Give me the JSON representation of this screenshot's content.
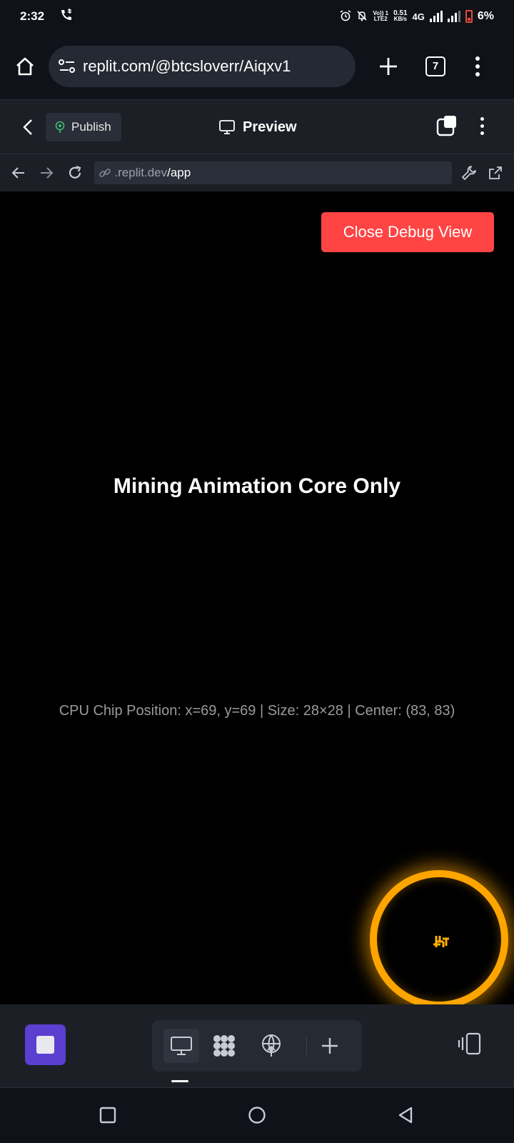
{
  "status_bar": {
    "time": "2:32",
    "net_top": "Vo)) 1",
    "net_bottom": "LTE2",
    "speed_top": "0.51",
    "speed_bottom": "KB/s",
    "network": "4G",
    "battery": "6%",
    "icons": [
      "wifi-call-icon",
      "alarm-icon",
      "bell-off-icon",
      "signal-icon",
      "battery-low-icon"
    ]
  },
  "browser": {
    "url": "replit.com/@btcsloverr/Aiqxv1",
    "tab_count": "7"
  },
  "replit_toolbar": {
    "publish_label": "Publish",
    "preview_label": "Preview"
  },
  "address": {
    "domain": ".replit.dev",
    "path": "/app"
  },
  "content": {
    "close_debug_label": "Close Debug View",
    "title": "Mining Animation Core Only",
    "debug_info": "CPU Chip Position: x=69, y=69 | Size: 28×28 | Center: (83, 83)",
    "ring_color": "#ffa500",
    "chip_color": "#ffb000"
  },
  "colors": {
    "close_button": "#ff4444",
    "stop_button": "#5b3fd1",
    "publish_icon": "#3fbf6f"
  }
}
